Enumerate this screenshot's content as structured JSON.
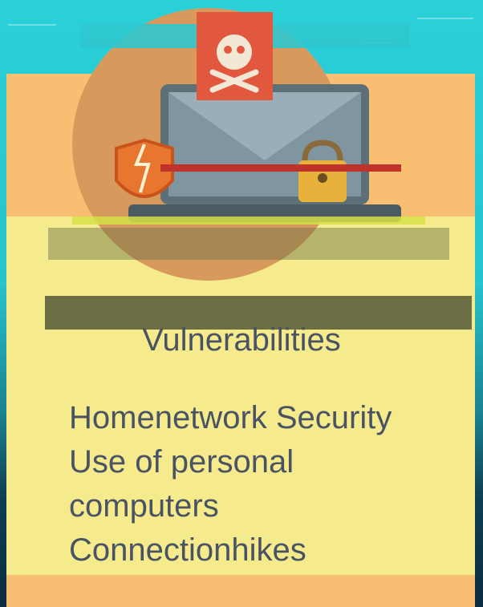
{
  "slide": {
    "title": "Vulnerabilities",
    "bullets": [
      "Homenetwork Security",
      "Use of personal",
      "computers",
      "Connectionhikes"
    ]
  },
  "colors": {
    "background_top": "#2ad0d8",
    "background_bottom": "#0b2b3e",
    "card": "#f5eb8c",
    "card_band": "#f8be72",
    "text": "#4a5364"
  },
  "icons": [
    "skull-crossbones-icon",
    "envelope-icon",
    "shield-icon",
    "padlock-icon",
    "laptop-icon"
  ]
}
